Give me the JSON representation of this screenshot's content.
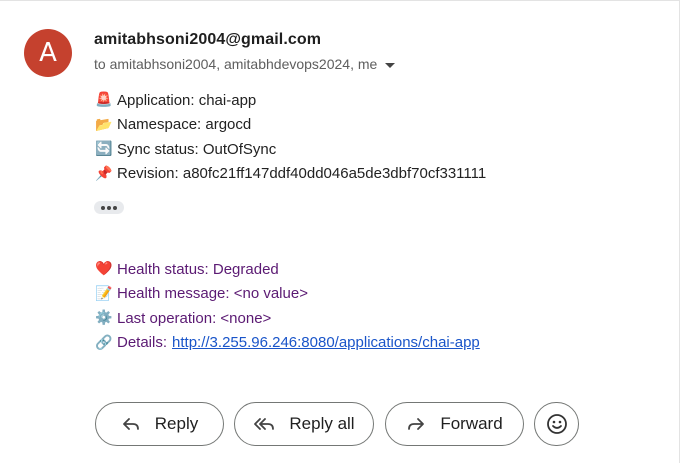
{
  "sender": {
    "avatar_letter": "A",
    "avatar_color": "#c5412e",
    "email": "amitabhsoni2004@gmail.com",
    "recipients": "to amitabhsoni2004, amitabhdevops2024, me"
  },
  "body": {
    "lines_top": [
      {
        "icon": "🚨",
        "text": "Application: chai-app"
      },
      {
        "icon": "📂",
        "text": "Namespace: argocd"
      },
      {
        "icon": "🔄",
        "text": "Sync status: OutOfSync"
      },
      {
        "icon": "📌",
        "text": "Revision: a80fc21ff147ddf40dd046a5de3dbf70cf331111"
      }
    ],
    "lines_bottom": [
      {
        "icon": "❤️",
        "text": "Health status: Degraded"
      },
      {
        "icon": "📝",
        "text": "Health message: <no value>"
      },
      {
        "icon": "⚙️",
        "text": "Last operation: <none>"
      },
      {
        "icon": "🔗",
        "text": "Details:",
        "link": "http://3.255.96.246:8080/applications/chai-app"
      }
    ]
  },
  "actions": {
    "reply": "Reply",
    "reply_all": "Reply all",
    "forward": "Forward"
  }
}
